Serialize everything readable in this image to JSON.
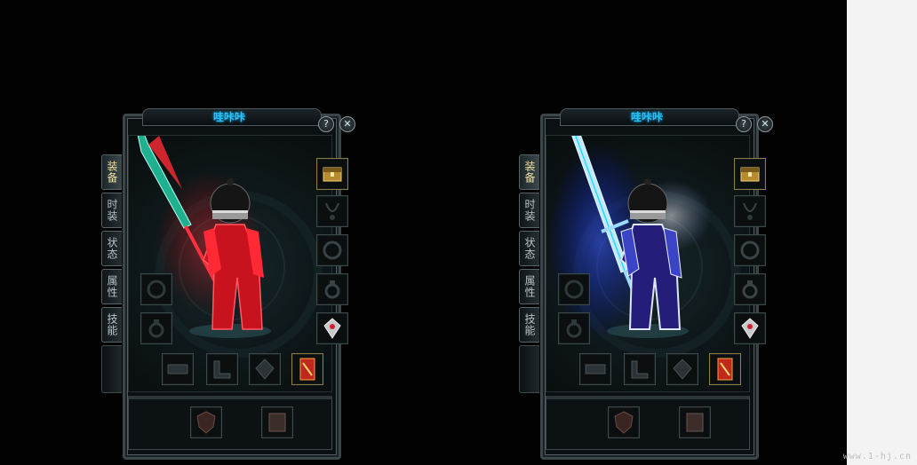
{
  "panels": [
    {
      "title": "哇咔咔",
      "theme": "red",
      "help_label": "?",
      "close_label": "✕",
      "tabs": [
        "装备",
        "时装",
        "状态",
        "属性",
        "技能"
      ],
      "active_tab": 0,
      "glow_color": "#ff1f2a",
      "weapon_color": "#1fb090"
    },
    {
      "title": "哇咔咔",
      "theme": "blue",
      "help_label": "?",
      "close_label": "✕",
      "tabs": [
        "装备",
        "时装",
        "状态",
        "属性",
        "技能"
      ],
      "active_tab": 0,
      "glow_color": "#2a4bff",
      "weapon_color": "#9adcff"
    }
  ],
  "slot_icons": {
    "right_column": [
      "chest-icon",
      "necklace-icon",
      "bracelet-icon",
      "ring-icon",
      "medal-icon"
    ],
    "left_column": [
      "bracelet-icon",
      "ring-icon"
    ],
    "bottom_row": [
      "belt-icon",
      "boots-icon",
      "gem-icon",
      "talisman-icon"
    ],
    "extra_row": [
      "shield-icon",
      "rune-icon"
    ]
  },
  "watermark": "www.1-hj.cn"
}
